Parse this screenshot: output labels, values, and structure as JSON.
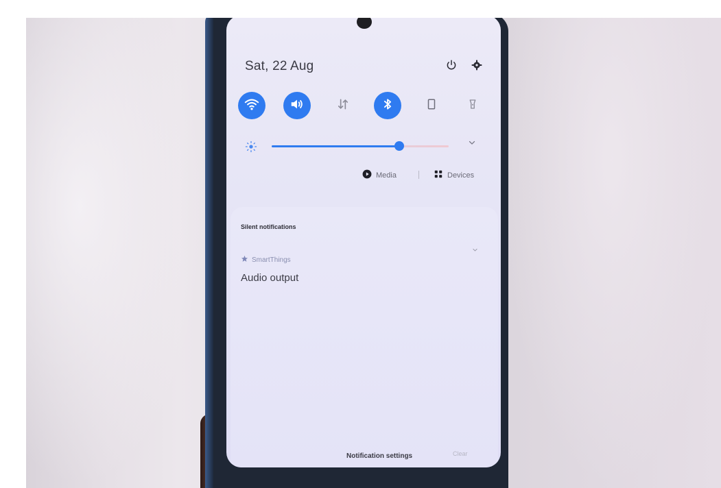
{
  "header": {
    "date": "Sat, 22 Aug",
    "power_icon": "power-icon",
    "settings_icon": "gear-icon"
  },
  "quick_settings": [
    {
      "name": "wifi",
      "icon": "wifi-icon",
      "active": true
    },
    {
      "name": "sound",
      "icon": "volume-icon",
      "active": true
    },
    {
      "name": "mobile-data",
      "icon": "data-arrows-icon",
      "active": false
    },
    {
      "name": "bluetooth",
      "icon": "bluetooth-icon",
      "active": true
    },
    {
      "name": "auto-rotate",
      "icon": "rotate-icon",
      "active": false
    },
    {
      "name": "flashlight",
      "icon": "torch-icon",
      "active": false
    }
  ],
  "brightness": {
    "level": 0.72
  },
  "controls": {
    "media_label": "Media",
    "devices_label": "Devices"
  },
  "notifications": {
    "section_title": "Silent notifications",
    "app_name": "SmartThings",
    "text": "Audio output"
  },
  "footer": {
    "settings_label": "Notification settings",
    "clear_label": "Clear"
  },
  "colors": {
    "accent": "#2f7bf0",
    "panel_bg": "#e6e5f6"
  }
}
